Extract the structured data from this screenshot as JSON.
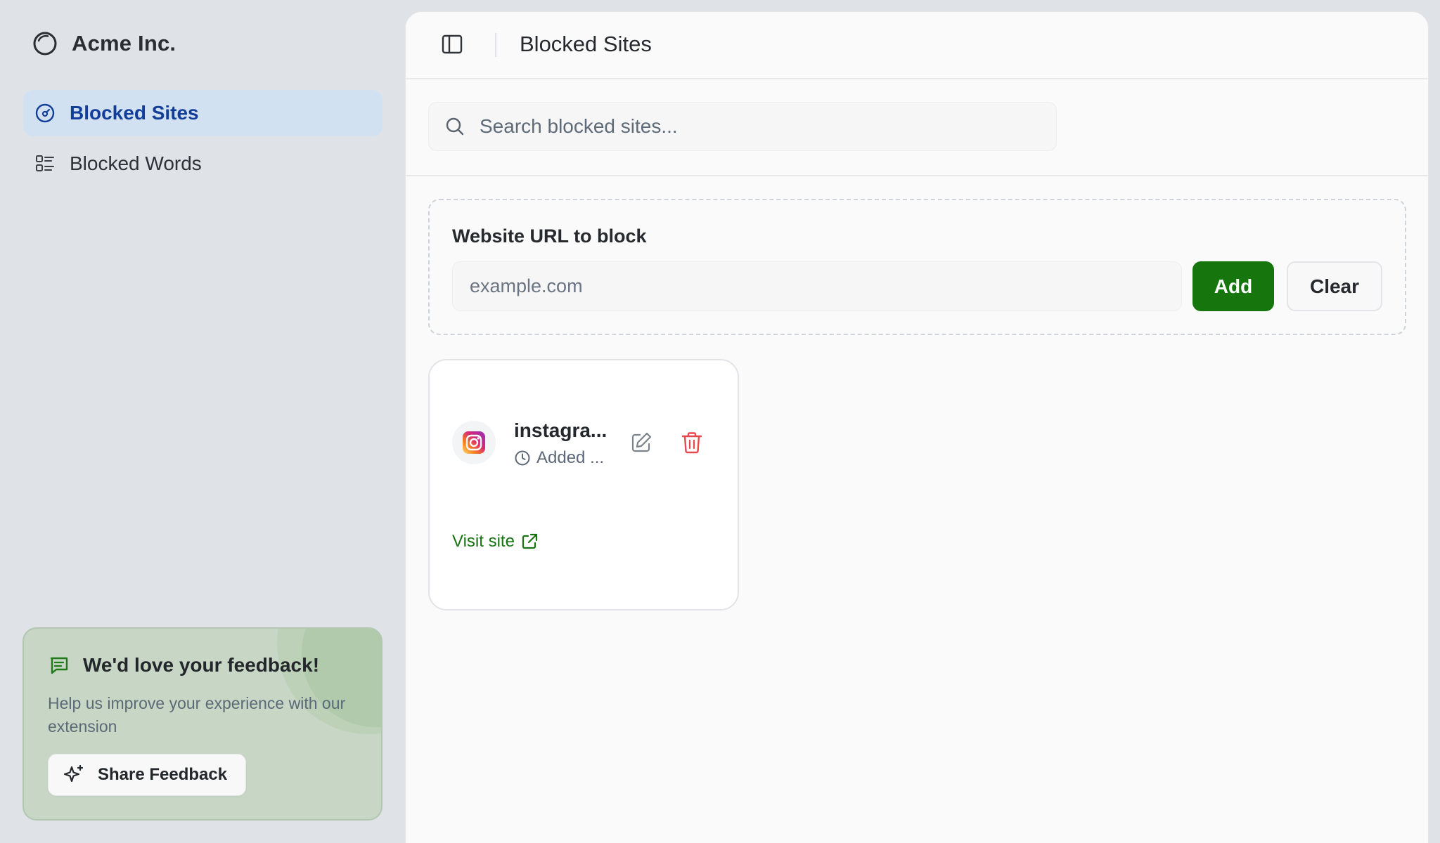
{
  "brand": {
    "name": "Acme Inc.",
    "icon": "circle-logo-icon"
  },
  "sidebar": {
    "items": [
      {
        "label": "Blocked Sites",
        "icon": "gauge-icon",
        "active": true
      },
      {
        "label": "Blocked Words",
        "icon": "list-icon",
        "active": false
      }
    ]
  },
  "feedback": {
    "title": "We'd love your feedback!",
    "text": "Help us improve your experience with our extension",
    "button_label": "Share Feedback",
    "icon": "message-square-icon",
    "button_icon": "sparkles-icon"
  },
  "header": {
    "title": "Blocked Sites",
    "toggle_icon": "sidebar-toggle-icon"
  },
  "search": {
    "placeholder": "Search blocked sites...",
    "value": ""
  },
  "add_form": {
    "label": "Website URL to block",
    "placeholder": "example.com",
    "value": "",
    "add_label": "Add",
    "clear_label": "Clear"
  },
  "sites": [
    {
      "name": "instagra...",
      "added": "Added ...",
      "favicon": "instagram-icon",
      "visit_label": "Visit site"
    }
  ],
  "colors": {
    "accent_green": "#16750c",
    "nav_active_bg": "#d2e1f1",
    "nav_active_text": "#123e9a",
    "delete_red": "#e5484d",
    "feedback_bg": "#c7d6c5"
  }
}
